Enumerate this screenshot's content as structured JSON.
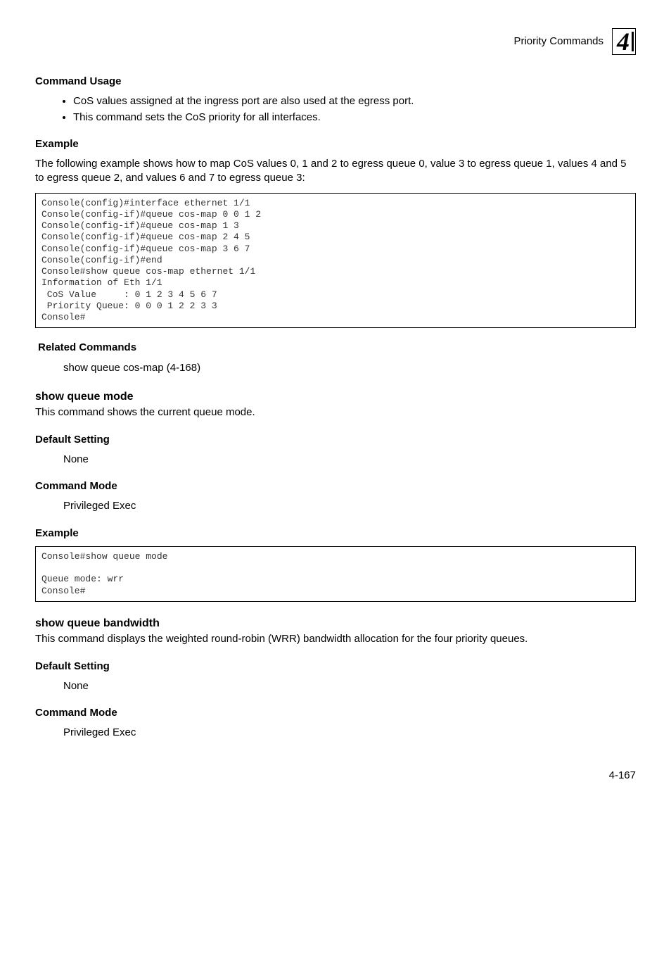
{
  "header": {
    "section_title": "Priority Commands",
    "logo_text": "4"
  },
  "blocks": {
    "command_usage": {
      "heading": "Command Usage",
      "bullets": [
        "CoS values assigned at the ingress port are also used at the egress port.",
        "This command sets the CoS priority for all interfaces."
      ]
    },
    "example1": {
      "heading": "Example",
      "intro": "The following example shows how to map CoS values 0, 1 and 2 to egress queue 0, value 3 to egress queue 1, values 4 and 5 to egress queue 2, and values 6 and 7 to egress queue 3:",
      "code": "Console(config)#interface ethernet 1/1\nConsole(config-if)#queue cos-map 0 0 1 2\nConsole(config-if)#queue cos-map 1 3\nConsole(config-if)#queue cos-map 2 4 5\nConsole(config-if)#queue cos-map 3 6 7\nConsole(config-if)#end\nConsole#show queue cos-map ethernet 1/1\nInformation of Eth 1/1\n CoS Value     : 0 1 2 3 4 5 6 7\n Priority Queue: 0 0 0 1 2 2 3 3\nConsole#"
    },
    "related_commands": {
      "heading": "Related Commands",
      "text": "show queue cos-map (4-168)"
    },
    "show_queue_mode": {
      "heading": "show queue mode",
      "desc": "This command shows the current queue mode.",
      "default_heading": "Default Setting",
      "default_value": "None",
      "mode_heading": "Command Mode",
      "mode_value": "Privileged Exec",
      "example_heading": "Example",
      "code": "Console#show queue mode\n\nQueue mode: wrr\nConsole#"
    },
    "show_queue_bandwidth": {
      "heading": "show queue bandwidth",
      "desc": "This command displays the weighted round-robin (WRR) bandwidth allocation for the four priority queues.",
      "default_heading": "Default Setting",
      "default_value": "None",
      "mode_heading": "Command Mode",
      "mode_value": "Privileged Exec"
    }
  },
  "page_number": "4-167"
}
